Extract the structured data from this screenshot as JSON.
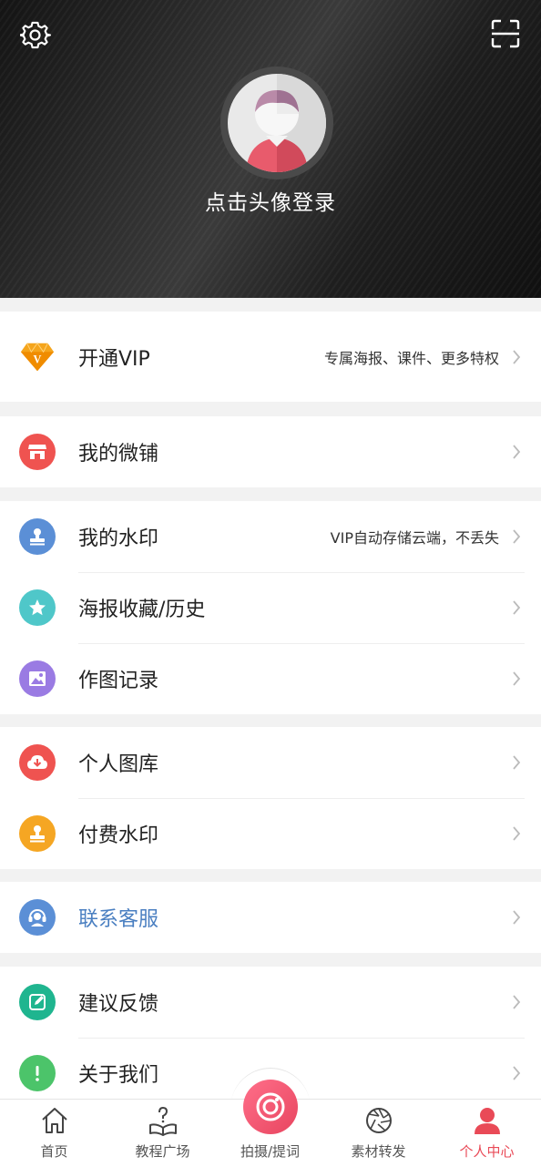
{
  "header": {
    "login_prompt": "点击头像登录"
  },
  "menu": {
    "vip": {
      "label": "开通VIP",
      "desc": "专属海报、课件、更多特权"
    },
    "shop": {
      "label": "我的微铺"
    },
    "watermark": {
      "label": "我的水印",
      "desc": "VIP自动存储云端，不丢失"
    },
    "poster": {
      "label": "海报收藏/历史"
    },
    "records": {
      "label": "作图记录"
    },
    "gallery": {
      "label": "个人图库"
    },
    "paid_watermark": {
      "label": "付费水印"
    },
    "support": {
      "label": "联系客服"
    },
    "feedback": {
      "label": "建议反馈"
    },
    "about": {
      "label": "关于我们"
    }
  },
  "tabs": [
    {
      "label": "首页",
      "icon": "home-icon"
    },
    {
      "label": "教程广场",
      "icon": "book-question-icon"
    },
    {
      "label": "拍摄/提词",
      "icon": "camera-icon"
    },
    {
      "label": "素材转发",
      "icon": "aperture-icon"
    },
    {
      "label": "个人中心",
      "icon": "user-icon",
      "active": true
    }
  ],
  "colors": {
    "accent": "#e94a57",
    "support_text": "#4a7fc1",
    "icon_red": "#ef5350",
    "icon_blue": "#5b8fd6",
    "icon_teal": "#4fc7c9",
    "icon_purple": "#9a7be3",
    "icon_orange": "#f5a623",
    "icon_green": "#1fb58f",
    "icon_lightgreen": "#4cc46a"
  }
}
